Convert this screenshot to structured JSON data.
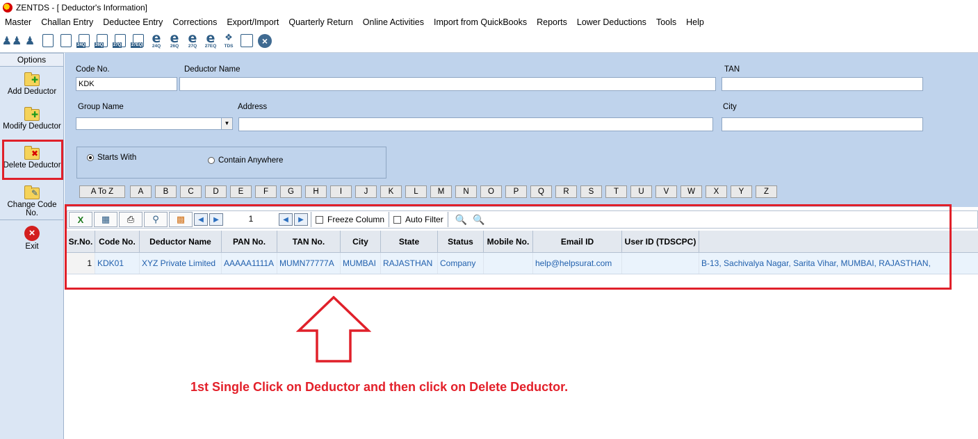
{
  "window": {
    "title": "ZENTDS - [ Deductor's Information]"
  },
  "menu": [
    "Master",
    "Challan Entry",
    "Deductee Entry",
    "Corrections",
    "Export/Import",
    "Quarterly Return",
    "Online Activities",
    "Import from QuickBooks",
    "Reports",
    "Lower Deductions",
    "Tools",
    "Help"
  ],
  "toolbar": {
    "icons": [
      "people-icon",
      "person-icon",
      "doc-icon",
      "doc-icon",
      "doc-24q-icon",
      "doc-26q-icon",
      "doc-27q-icon",
      "doc-27eq-icon",
      "e-24q-icon",
      "e-26q-icon",
      "e-27q-icon",
      "e-27eq-icon",
      "tds-logo-icon",
      "form-icon",
      "close-circle-icon"
    ],
    "tags": {
      "t24q": "24Q",
      "t26q": "26Q",
      "t27q": "27Q",
      "t27eq": "27EQ",
      "tds": "TDS"
    }
  },
  "sidebar": {
    "header": "Options",
    "items": [
      {
        "label": "Add Deductor"
      },
      {
        "label": "Modify Deductor"
      },
      {
        "label": "Delete Deductor"
      },
      {
        "label": "Change Code No."
      },
      {
        "label": "Exit"
      }
    ]
  },
  "form": {
    "code_label": "Code No.",
    "code_value": "KDK",
    "name_label": "Deductor Name",
    "name_value": "",
    "tan_label": "TAN",
    "tan_value": "",
    "group_label": "Group Name",
    "group_value": "",
    "address_label": "Address",
    "address_value": "",
    "city_label": "City",
    "city_value": "",
    "radio_starts": "Starts With",
    "radio_contain": "Contain Anywhere",
    "selected_radio": "Starts With"
  },
  "letters": [
    "A To Z",
    "A",
    "B",
    "C",
    "D",
    "E",
    "F",
    "G",
    "H",
    "I",
    "J",
    "K",
    "L",
    "M",
    "N",
    "O",
    "P",
    "Q",
    "R",
    "S",
    "T",
    "U",
    "V",
    "W",
    "X",
    "Y",
    "Z"
  ],
  "grid_toolbar": {
    "page": "1",
    "freeze_label": "Freeze Column",
    "autofilter_label": "Auto Filter"
  },
  "grid": {
    "columns": [
      "Sr.No.",
      "Code No.",
      "Deductor Name",
      "PAN No.",
      "TAN No.",
      "City",
      "State",
      "Status",
      "Mobile No.",
      "Email ID",
      "User ID (TDSCPC)",
      ""
    ],
    "rows": [
      [
        "1",
        "KDK01",
        "XYZ Private Limited",
        "AAAAA1111A",
        "MUMN77777A",
        "MUMBAI",
        "RAJASTHAN",
        "Company",
        "",
        "help@helpsurat.com",
        "",
        "B-13, Sachivalya Nagar, Sarita Vihar, MUMBAI, RAJASTHAN,"
      ]
    ]
  },
  "annotation": {
    "instruction": "1st Single Click on Deductor and then click on Delete Deductor.",
    "highlight_color": "#e0202a"
  }
}
